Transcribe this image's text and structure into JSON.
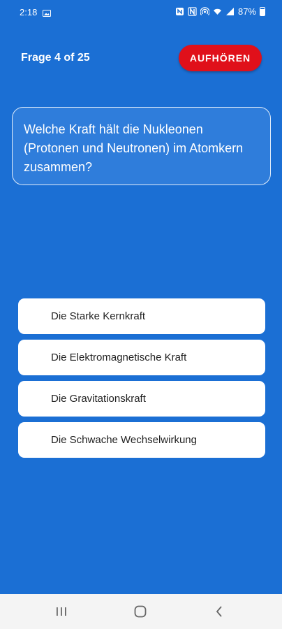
{
  "status_bar": {
    "time": "2:18",
    "battery": "87%",
    "icons": [
      "gallery-icon",
      "nfc-icon",
      "n-icon",
      "hotspot-icon",
      "wifi-icon",
      "signal-icon",
      "battery-icon"
    ]
  },
  "header": {
    "counter": "Frage 4 of 25",
    "quit_label": "AUFHÖREN"
  },
  "question": {
    "text": "Welche Kraft hält die Nukleonen (Protonen und Neutronen) im Atomkern zusammen?"
  },
  "answers": [
    {
      "label": "Die Starke Kernkraft"
    },
    {
      "label": "Die Elektromagnetische Kraft"
    },
    {
      "label": "Die Gravitationskraft"
    },
    {
      "label": "Die Schwache Wechselwirkung"
    }
  ],
  "nav_bar": {
    "icons": [
      "recents-icon",
      "home-icon",
      "back-icon"
    ]
  },
  "colors": {
    "background": "#1b6fd4",
    "quit_button": "#e0101a",
    "answer_bg": "#ffffff"
  }
}
